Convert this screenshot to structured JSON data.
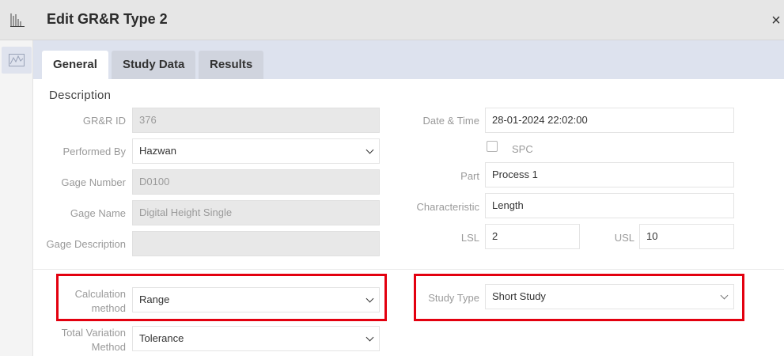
{
  "window": {
    "title": "Edit GR&R Type 2",
    "close_label": "×"
  },
  "tabs": [
    {
      "label": "General",
      "active": true
    },
    {
      "label": "Study Data",
      "active": false
    },
    {
      "label": "Results",
      "active": false
    }
  ],
  "section": {
    "label": "Description"
  },
  "form": {
    "grr_id": {
      "label": "GR&R ID",
      "value": "376"
    },
    "performed_by": {
      "label": "Performed By",
      "value": "Hazwan"
    },
    "gage_number": {
      "label": "Gage Number",
      "value": "D0100"
    },
    "gage_name": {
      "label": "Gage Name",
      "value": "Digital Height Single"
    },
    "gage_description": {
      "label": "Gage Description",
      "value": ""
    },
    "calculation_method": {
      "label_line1": "Calculation",
      "label_line2": "method",
      "value": "Range"
    },
    "total_variation_method": {
      "label_line1": "Total Variation",
      "label_line2": "Method",
      "value": "Tolerance"
    },
    "date_time": {
      "label": "Date & Time",
      "value": "28-01-2024 22:02:00"
    },
    "spc": {
      "label": "SPC",
      "checked": false
    },
    "part": {
      "label": "Part",
      "value": "Process 1"
    },
    "characteristic": {
      "label": "Characteristic",
      "value": "Length"
    },
    "lsl": {
      "label": "LSL",
      "value": "2"
    },
    "usl": {
      "label": "USL",
      "value": "10"
    },
    "study_type": {
      "label": "Study Type",
      "value": "Short Study"
    }
  },
  "icons": {
    "app": "bar-chart-icon",
    "rail": "line-chart-icon",
    "close": "close-icon"
  },
  "colors": {
    "highlight": "#e3000f",
    "tabstrip": "#dde2ee"
  }
}
